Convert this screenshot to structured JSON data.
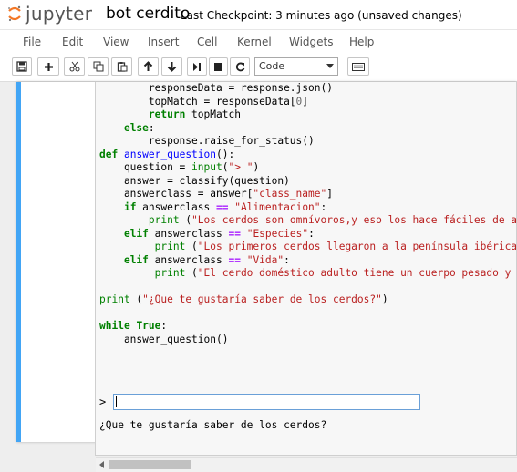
{
  "header": {
    "logo_text": "jupyter",
    "notebook_name": "bot cerdito",
    "checkpoint": "Last Checkpoint: 3 minutes ago (unsaved changes)"
  },
  "menu": [
    "File",
    "Edit",
    "View",
    "Insert",
    "Cell",
    "Kernel",
    "Widgets",
    "Help"
  ],
  "toolbar": {
    "cell_type": "Code",
    "buttons": [
      "save-icon",
      "add-icon",
      "cut-icon",
      "copy-icon",
      "paste-icon",
      "move-up-icon",
      "move-down-icon",
      "run-icon",
      "stop-icon",
      "restart-icon",
      "keyboard-icon"
    ]
  },
  "code_lines": [
    [
      {
        "t": "        responseData = response.json()",
        "c": ""
      }
    ],
    [
      {
        "t": "        topMatch = responseData[",
        "c": ""
      },
      {
        "t": "0",
        "c": "num"
      },
      {
        "t": "]",
        "c": ""
      }
    ],
    [
      {
        "t": "        ",
        "c": ""
      },
      {
        "t": "return",
        "c": "kw"
      },
      {
        "t": " topMatch",
        "c": ""
      }
    ],
    [
      {
        "t": "    ",
        "c": ""
      },
      {
        "t": "else",
        "c": "kw"
      },
      {
        "t": ":",
        "c": ""
      }
    ],
    [
      {
        "t": "        response.raise_for_status()",
        "c": ""
      }
    ],
    [
      {
        "t": "def",
        "c": "kw"
      },
      {
        "t": " ",
        "c": ""
      },
      {
        "t": "answer_question",
        "c": "fn"
      },
      {
        "t": "():",
        "c": ""
      }
    ],
    [
      {
        "t": "    question = ",
        "c": ""
      },
      {
        "t": "input",
        "c": "bi"
      },
      {
        "t": "(",
        "c": ""
      },
      {
        "t": "\"> \"",
        "c": "str"
      },
      {
        "t": ")",
        "c": ""
      }
    ],
    [
      {
        "t": "    answer = classify(question)",
        "c": ""
      }
    ],
    [
      {
        "t": "    answerclass = answer[",
        "c": ""
      },
      {
        "t": "\"class_name\"",
        "c": "str"
      },
      {
        "t": "]",
        "c": ""
      }
    ],
    [
      {
        "t": "    ",
        "c": ""
      },
      {
        "t": "if",
        "c": "kw"
      },
      {
        "t": " answerclass ",
        "c": ""
      },
      {
        "t": "==",
        "c": "op"
      },
      {
        "t": " ",
        "c": ""
      },
      {
        "t": "\"Alimentacion\"",
        "c": "str"
      },
      {
        "t": ":",
        "c": ""
      }
    ],
    [
      {
        "t": "        ",
        "c": ""
      },
      {
        "t": "print",
        "c": "bi"
      },
      {
        "t": " (",
        "c": ""
      },
      {
        "t": "\"Los cerdos son omnívoros,y eso los hace fáciles de ali",
        "c": "str"
      }
    ],
    [
      {
        "t": "    ",
        "c": ""
      },
      {
        "t": "elif",
        "c": "kw"
      },
      {
        "t": " answerclass ",
        "c": ""
      },
      {
        "t": "==",
        "c": "op"
      },
      {
        "t": " ",
        "c": ""
      },
      {
        "t": "\"Especies\"",
        "c": "str"
      },
      {
        "t": ":",
        "c": ""
      }
    ],
    [
      {
        "t": "         ",
        "c": ""
      },
      {
        "t": "print",
        "c": "bi"
      },
      {
        "t": " (",
        "c": ""
      },
      {
        "t": "\"Los primeros cerdos llegaron a la península ibérica e",
        "c": "str"
      }
    ],
    [
      {
        "t": "    ",
        "c": ""
      },
      {
        "t": "elif",
        "c": "kw"
      },
      {
        "t": " answerclass ",
        "c": ""
      },
      {
        "t": "==",
        "c": "op"
      },
      {
        "t": " ",
        "c": ""
      },
      {
        "t": "\"Vida\"",
        "c": "str"
      },
      {
        "t": ":",
        "c": ""
      }
    ],
    [
      {
        "t": "         ",
        "c": ""
      },
      {
        "t": "print",
        "c": "bi"
      },
      {
        "t": " (",
        "c": ""
      },
      {
        "t": "\"El cerdo doméstico adulto tiene un cuerpo pesado y re",
        "c": "str"
      }
    ],
    [
      {
        "t": "",
        "c": ""
      }
    ],
    [
      {
        "t": "print",
        "c": "bi"
      },
      {
        "t": " (",
        "c": ""
      },
      {
        "t": "\"¿Que te gustaría saber de los cerdos?\"",
        "c": "str"
      },
      {
        "t": ")",
        "c": ""
      }
    ],
    [
      {
        "t": "",
        "c": ""
      }
    ],
    [
      {
        "t": "while",
        "c": "kw"
      },
      {
        "t": " ",
        "c": ""
      },
      {
        "t": "True",
        "c": "kw"
      },
      {
        "t": ":",
        "c": ""
      }
    ],
    [
      {
        "t": "    answer_question()",
        "c": ""
      }
    ]
  ],
  "input": {
    "prompt": ">",
    "value": ""
  },
  "output": "¿Que te gustaría saber de los cerdos?"
}
